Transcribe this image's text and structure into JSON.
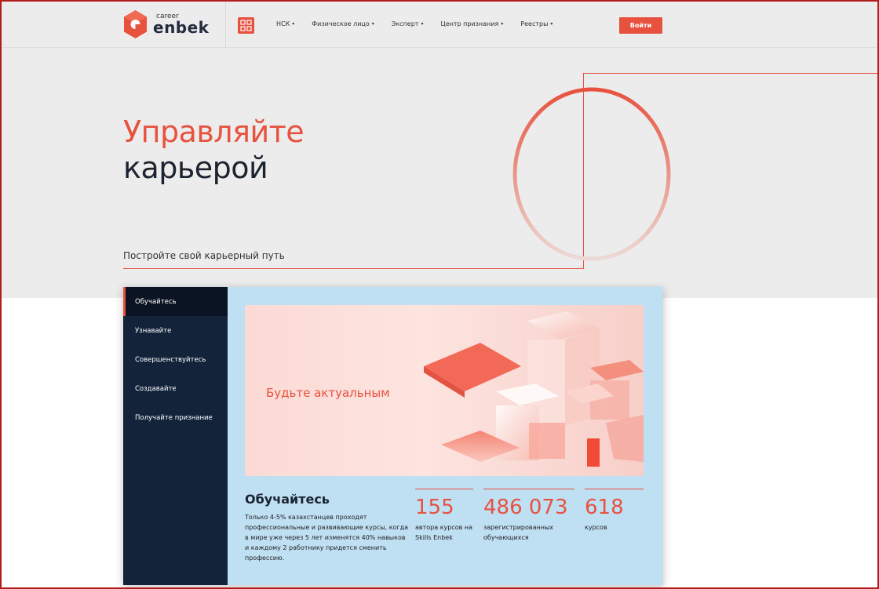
{
  "header": {
    "logo_small": "career",
    "logo_big": "enbek",
    "nav": [
      {
        "label": "НСК"
      },
      {
        "label": "Физическое лицо"
      },
      {
        "label": "Эксперт"
      },
      {
        "label": "Центр признания"
      },
      {
        "label": "Реестры"
      }
    ],
    "login_label": "Войти"
  },
  "hero": {
    "title_line1": "Управляйте",
    "title_line2": "карьерой",
    "subtitle": "Постройте свой карьерный путь"
  },
  "sidebar": {
    "items": [
      {
        "label": "Обучайтесь",
        "active": true
      },
      {
        "label": "Узнавайте",
        "active": false
      },
      {
        "label": "Совершенствуйтесь",
        "active": false
      },
      {
        "label": "Создавайте",
        "active": false
      },
      {
        "label": "Получайте признание",
        "active": false
      }
    ]
  },
  "content": {
    "banner_text": "Будьте актуальным",
    "title": "Обучайтесь",
    "description": "Только 4-5% казахстанцев проходят профессиональные и развивающие курсы, когда в мире уже через 5 лет изменятся 40% навыков и каждому 2 работнику придется сменить профессию.",
    "stats": [
      {
        "value": "155",
        "label": "автора курсов на Skills Enbek"
      },
      {
        "value": "486 073",
        "label": "зарегистрированных обучающихся"
      },
      {
        "value": "618",
        "label": "курсов"
      }
    ]
  },
  "colors": {
    "accent": "#e7523f",
    "sidebar_bg": "#12233a",
    "content_bg": "#bfdff3",
    "hero_bg": "#ececec"
  }
}
